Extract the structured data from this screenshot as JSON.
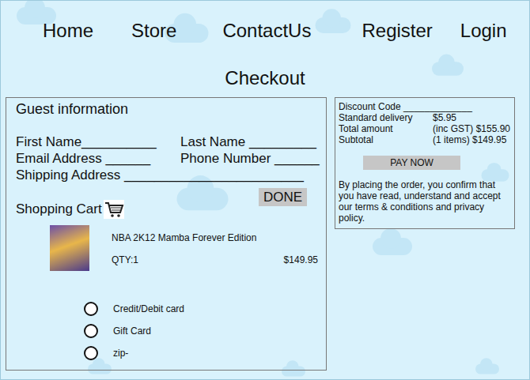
{
  "nav": [
    "Home",
    "Store",
    "ContactUs",
    "Register",
    "Login"
  ],
  "page_title": "Checkout",
  "guest": {
    "title": "Guest information",
    "fields": [
      "First Name__________",
      "Last Name _________",
      "Email Address ______",
      "Phone Number ______"
    ],
    "shipping": "Shipping Address ________________________",
    "done_button": "DONE"
  },
  "cart": {
    "title": "Shopping Cart",
    "items": [
      {
        "name": "NBA 2K12 Mamba Forever Edition",
        "qty": "QTY:1",
        "price": "$149.95"
      }
    ]
  },
  "payment_options": [
    {
      "label": "Credit/Debit card",
      "selected": false
    },
    {
      "label": "Gift Card",
      "selected": false
    },
    {
      "label": "zip-",
      "selected": false
    }
  ],
  "summary": {
    "discount_label": "Discount Code _____________",
    "rows": [
      {
        "label": "Standard delivery",
        "value": "$5.95"
      },
      {
        "label": "Total amount",
        "value": "(inc GST) $155.90"
      },
      {
        "label": "Subtotal",
        "value": "(1 items) $149.95"
      }
    ],
    "button": "PAY NOW",
    "terms": "By placing the order, you confirm that you have read, understand and accept our terms & conditions and privacy policy."
  }
}
